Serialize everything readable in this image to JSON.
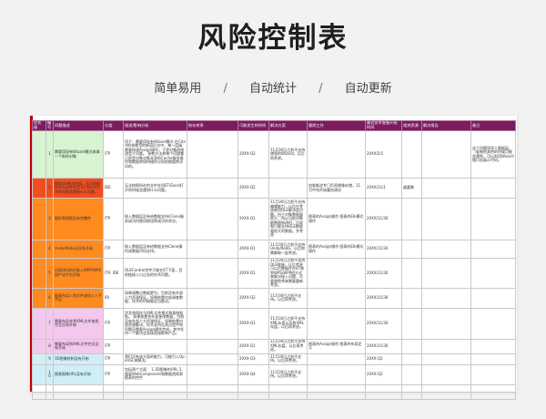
{
  "header": {
    "title": "风险控制表",
    "subtitle_items": [
      "简单易用",
      "自动统计",
      "自动更新"
    ],
    "separator": "/"
  },
  "table": {
    "columns": [
      "优先级",
      "编号",
      "问题描述",
      "分类",
      "描述/影响分析",
      "依存关系",
      "可能发生的时间",
      "解决方案",
      "跟踪工作",
      "最迟技术准备开始时间",
      "相关资源",
      "解决报告",
      "备注"
    ],
    "rows": [
      {
        "prio_color": "g",
        "no": "1",
        "desc": "需要用现有Wizard模式来拿一个新的对象",
        "cat": "ITP",
        "impact": "用于：需要用现有Wizard模式\n\n在Chart的参数型的新容后台中，每一层级需要修改Assign操作，于是对象的修改会介问题。\n参数方法和每个问题都已经是对象对象本身的Cache服务操作和数据库保持操作分别的数据库访问的。",
        "dep": "",
        "time": "20XX-Q2",
        "plan": "11月30日之前不支持增强的Wizard。以后再考虑。",
        "track": "",
        "start": "20XX/2/1",
        "res": "",
        "report": "",
        "note": "这个问题同项人跟据因，（复制给其他的时候可能会遇到，可以利用Wizard接口去展示代码。"
      },
      {
        "prio_color": "r1",
        "no": "2",
        "desc": "需要ole格式时候，无法按照所在的文件在用 ET/Excel打开的时候会遇到什么问题。",
        "cat": "IDE",
        "impact": "无法按照所在的文件在用ET/Excel打开的时候会遇到什么问题。",
        "dep": "",
        "time": "20XX-Q2",
        "plan": "",
        "track": "由临推进专门负责缘像存储，11月中旬开始重启调试",
        "start": "20XX/11/1",
        "res": "盛嘉教",
        "report": "",
        "note": ""
      },
      {
        "prio_color": "o1",
        "no": "3",
        "desc": "图形和视图没有完整性",
        "cat": "ITP",
        "impact": "插入数据层没有给数据支持(Clone服务成功时使用按钮等成功的状况。",
        "dep": "",
        "time": "20XX-Q1",
        "plan": "11月30日之前不支持编辑能力，以后在考虑使用OLE解决此问题。由于对象数据量很大，所以当前对象能数据修改时，比较和只能支持OLE数据量很大的数据。并考虑",
        "track": "图表的Assign操作\n图表的EIk模式操作\n",
        "start": "20XX/11/30",
        "res": "",
        "report": "",
        "note": ""
      },
      {
        "prio_color": "o1",
        "no": "4",
        "desc": "Undo/Redo还没有开始",
        "cat": "ITP",
        "impact": "插入数据层没有给数据支持Clone操作成数据代码支持。",
        "dep": "",
        "time": "20XX-Q1",
        "plan": "11月30日之前不支持Undo/Redo。以后和需解取一起考虑。",
        "track": "图表的Assign操作\n图表的EIk模式操作",
        "start": "20XX/11/30",
        "res": "",
        "report": "",
        "note": ""
      },
      {
        "prio_color": "o1",
        "no": "5",
        "desc": "对接OLE的对接入WPP/WPS国产化平台开始",
        "cat": "ITP, IDE",
        "impact": "OLEControl控件只能在ET下面，目前链接入口过去的技术问题。",
        "dep": "",
        "time": "20XX-Q1",
        "plan": "11月30日之前不支持OLE链接。以后考虑可以后数据件在ET做到WPS/WPP的方式来解决接入问题，尽量避免将来需要重新考虑。",
        "track": "",
        "start": "20XX/11/30",
        "res": "",
        "report": "",
        "note": ""
      },
      {
        "prio_color": "o1",
        "no": "6",
        "desc": "图表布局入到文件查找入人手不足",
        "cat": "IRI",
        "impact": "如果调整过数据更为，目前没有外部人力资源保证。如果依靠内部调查数据，技术的时候能适当推动。",
        "dep": "",
        "time": "20XX-Q2",
        "plan": "11月30日之前不支持。以后再考虑。",
        "track": "",
        "start": "20XX/11/30",
        "res": "",
        "report": "",
        "note": ""
      },
      {
        "prio_color": "pk",
        "no": "7",
        "desc": "需要布局并到XML文件查找完全没有开始",
        "cat": "ITP",
        "impact": "涉及到保存为XML文件格式和复制粘贴。\n如果依靠到外部更改数据，目前没有外部人力资源保证。如果依靠内部资源解决，技术支持及其过程中和问题还需要Assign操作完成。其中任何一个解决会直接直接影响产品。",
        "dep": "",
        "time": "20XX-Q1",
        "plan": "11月30日之前不支持XML存盘以及和XML存盘，以后再考虑。",
        "track": "",
        "start": "20XX/11/30",
        "res": "",
        "report": "",
        "note": ""
      },
      {
        "prio_color": "pk",
        "no": "8",
        "desc": "需要布局到XML文件完全没有开始",
        "cat": "ITP",
        "impact": "",
        "dep": "",
        "time": "20XX-Q1",
        "plan": "11月30日之前不支持XML存盘。以后再考虑。",
        "track": "图表的Assign操作\n图表的布局定义",
        "start": "20XX/11/30",
        "res": "",
        "report": "",
        "note": ""
      },
      {
        "prio_color": "cy",
        "no": "9",
        "desc": "3D图像绘制没有开始",
        "cat": "ITP",
        "impact": "我们没有该方面的能力，可能引入OpenGL来解决。",
        "dep": "",
        "time": "20XX-Q3",
        "plan": "11月30日之前不支持。以后再考虑。",
        "track": "",
        "start": "20XX-Q2",
        "res": "",
        "report": "",
        "note": ""
      },
      {
        "prio_color": "cy",
        "no": "10",
        "desc": "图表图像URL没有开始",
        "cat": "ITP",
        "impact": "包括两个方面：\n1.3D图像的URL\n2.图表WebComponent和数据透视表图表的控件",
        "dep": "",
        "time": "20XX-Q4",
        "plan": "11月30日之前不支持。以后再考虑。",
        "track": "",
        "start": "20XX-Q2",
        "res": "",
        "report": "",
        "note": ""
      }
    ]
  }
}
